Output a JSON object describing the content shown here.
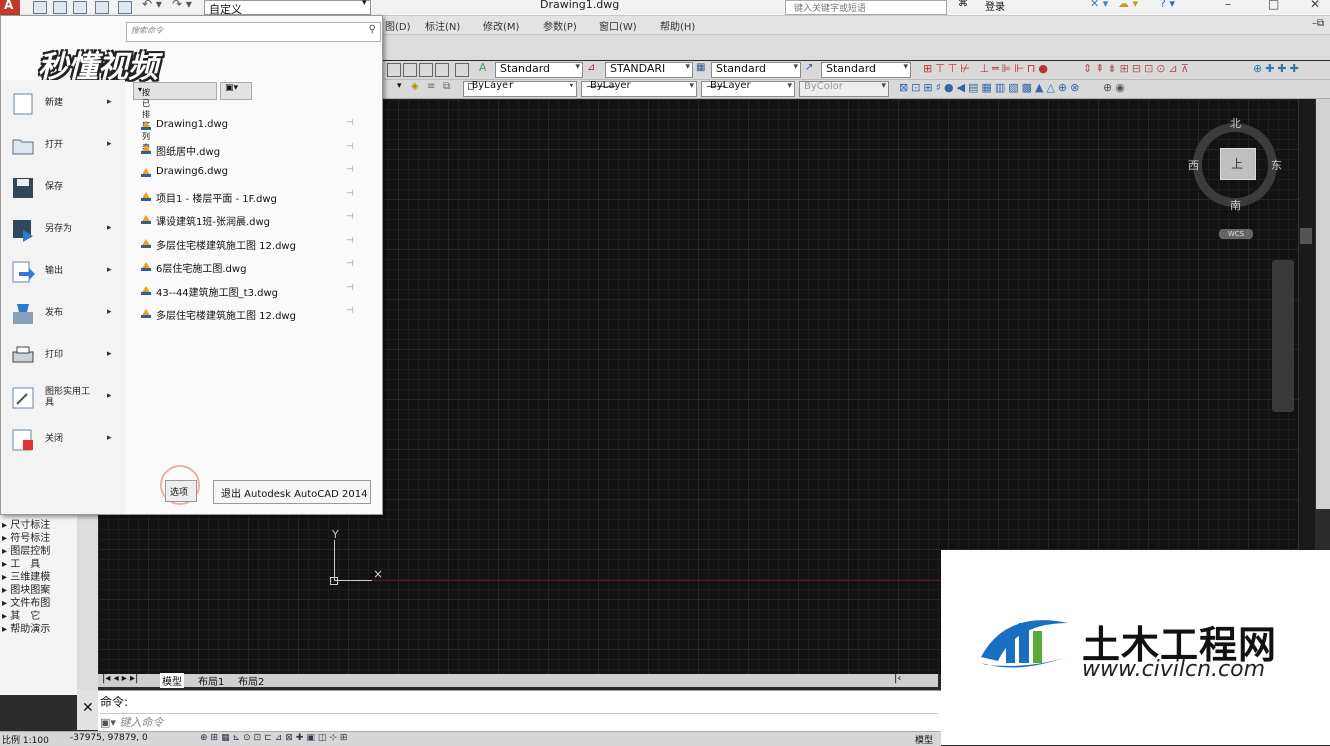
{
  "title_bar": {
    "workspace": "自定义",
    "document_title": "Drawing1.dwg",
    "search_placeholder": "键入关键字或短语",
    "login": "登录"
  },
  "menu_bar": [
    "图(D)",
    "标注(N)",
    "修改(M)",
    "参数(P)",
    "窗口(W)",
    "帮助(H)"
  ],
  "toolbar": {
    "text_style": "Standard",
    "dim_style": "STANDARI",
    "table_style": "Standard",
    "multileader_style": "Standard",
    "layer_color": "ByLayer",
    "linetype": "ByLayer",
    "lineweight": "ByLayer",
    "plot_style": "ByColor"
  },
  "viewcube": {
    "top": "北",
    "left": "西",
    "right": "东",
    "bottom": "南",
    "face": "上",
    "wcs": "WCS"
  },
  "app_menu": {
    "search_placeholder": "搜索命令",
    "brand": "秒懂视频",
    "sort_label": "按已排序列表",
    "items": [
      {
        "label": "新建",
        "icon": "new-file-icon",
        "arrow": "▸"
      },
      {
        "label": "打开",
        "icon": "open-folder-icon",
        "arrow": "▸"
      },
      {
        "label": "保存",
        "icon": "save-disk-icon",
        "arrow": ""
      },
      {
        "label": "另存为",
        "icon": "save-as-icon",
        "arrow": "▸"
      },
      {
        "label": "输出",
        "icon": "export-icon",
        "arrow": "▸"
      },
      {
        "label": "发布",
        "icon": "publish-icon",
        "arrow": "▸"
      },
      {
        "label": "打印",
        "icon": "printer-icon",
        "arrow": "▸"
      },
      {
        "label": "图形实用工具",
        "icon": "drawing-utilities-icon",
        "arrow": "▸"
      },
      {
        "label": "关闭",
        "icon": "close-file-icon",
        "arrow": "▸"
      }
    ],
    "recent_files": [
      "Drawing1.dwg",
      "图纸居中.dwg",
      "Drawing6.dwg",
      "项目1 - 楼层平面 - 1F.dwg",
      "课设建筑1班-张润晨.dwg",
      "多层住宅楼建筑施工图 12.dwg",
      "6层住宅施工图.dwg",
      "43--44建筑施工图_t3.dwg",
      "多层住宅楼建筑施工图 12.dwg"
    ],
    "options_label": "选项",
    "exit_label": "退出 Autodesk AutoCAD 2014"
  },
  "left_palette": [
    "尺寸标注",
    "符号标注",
    "图层控制",
    "工　具",
    "三维建模",
    "图块图案",
    "文件布图",
    "其　它",
    "帮助演示"
  ],
  "layout_tabs": [
    "模型",
    "布局1",
    "布局2"
  ],
  "command": {
    "label": "命令:",
    "placeholder": "键入命令"
  },
  "status": {
    "scale": "比例 1:100",
    "coords": "-37975, 97879, 0",
    "model": "模型"
  },
  "watermark": {
    "cn": "土木工程网",
    "url": "www.civilcn.com"
  },
  "colors": {
    "canvas": "#121212",
    "app_button": "#c0392b",
    "watermark_blue": "#1a6fc2"
  }
}
